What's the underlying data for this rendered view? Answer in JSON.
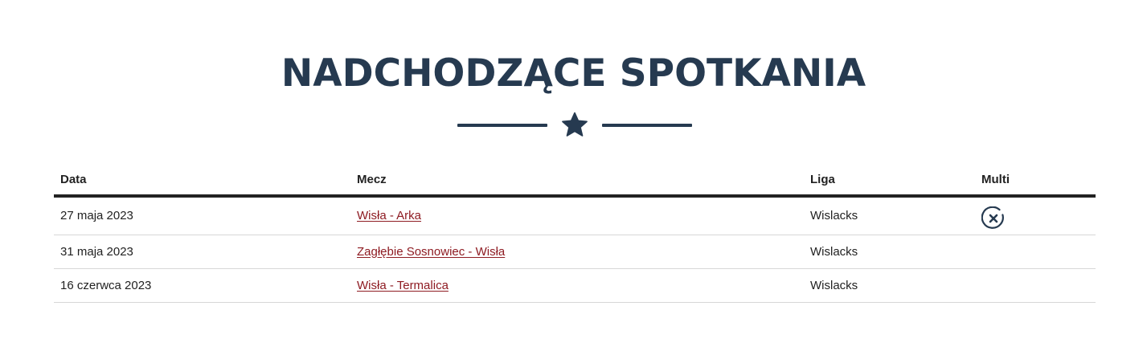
{
  "heading": {
    "title": "NADCHODZĄCE SPOTKANIA",
    "decoration_icon": "star-icon"
  },
  "colors": {
    "heading": "#263a50",
    "link": "#8e1b22",
    "text": "#222222",
    "row_border": "#d7d7d7"
  },
  "table": {
    "columns": [
      "Data",
      "Mecz",
      "Liga",
      "Multi"
    ],
    "rows": [
      {
        "date": "27 maja 2023",
        "match": "Wisła - Arka",
        "league": "Wislacks",
        "multi_icon": "close-circle-icon"
      },
      {
        "date": "31 maja 2023",
        "match": "Zagłębie Sosnowiec - Wisła",
        "league": "Wislacks",
        "multi_icon": ""
      },
      {
        "date": "16 czerwca 2023",
        "match": "Wisła - Termalica",
        "league": "Wislacks",
        "multi_icon": ""
      }
    ]
  }
}
